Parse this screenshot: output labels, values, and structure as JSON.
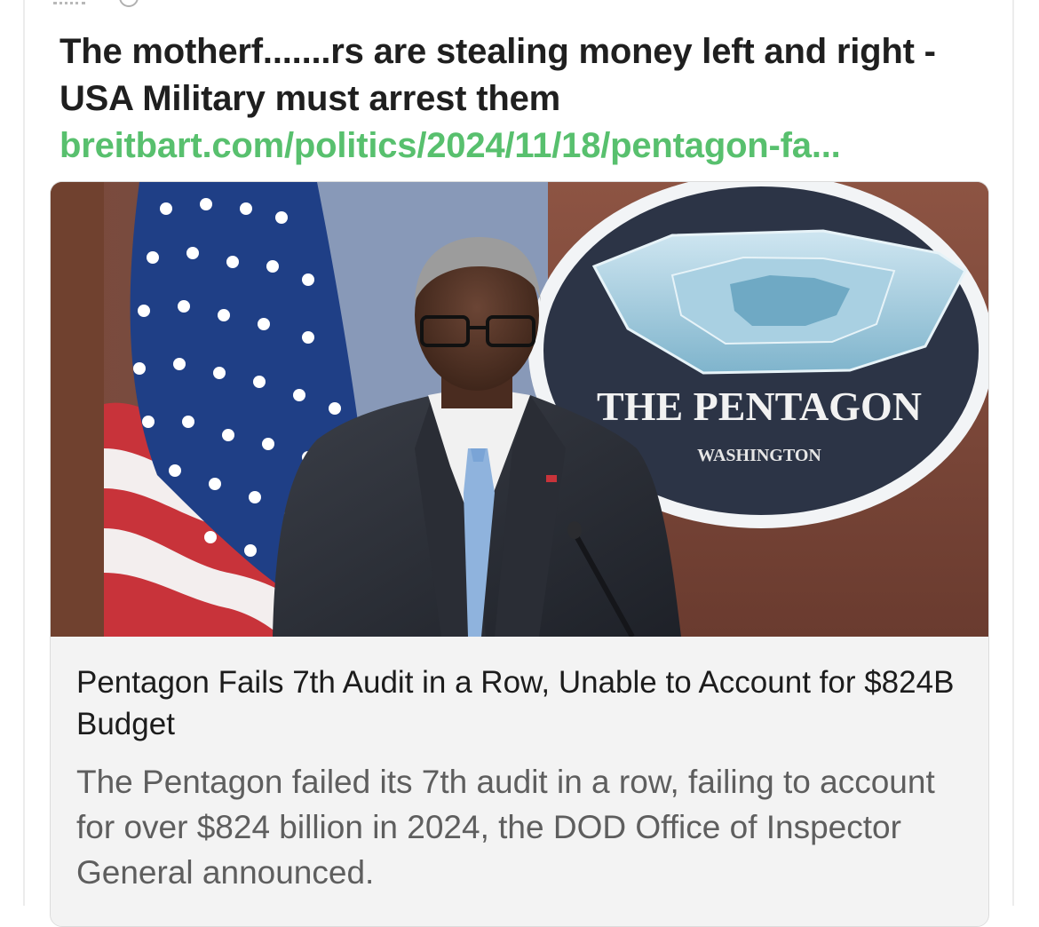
{
  "post": {
    "text": "The motherf.......rs are stealing money left and right - USA Military must arrest them",
    "link_text": "breitbart.com/politics/2024/11/18/pentagon-fa..."
  },
  "link_card": {
    "image": {
      "seal_title": "THE PENTAGON",
      "seal_subtitle": "WASHINGTON",
      "icons": [
        "us-flag",
        "pentagon-seal",
        "microphone"
      ]
    },
    "title": "Pentagon Fails 7th Audit in a Row, Unable to Account for $824B Budget",
    "description": "The Pentagon failed its 7th audit in a row, failing to account for over $824 billion in 2024, the DOD Office of Inspector General announced."
  },
  "colors": {
    "text": "#1f1f1f",
    "link": "#58c06e",
    "card_bg": "#f3f3f3",
    "card_desc": "#5e5e5e"
  }
}
